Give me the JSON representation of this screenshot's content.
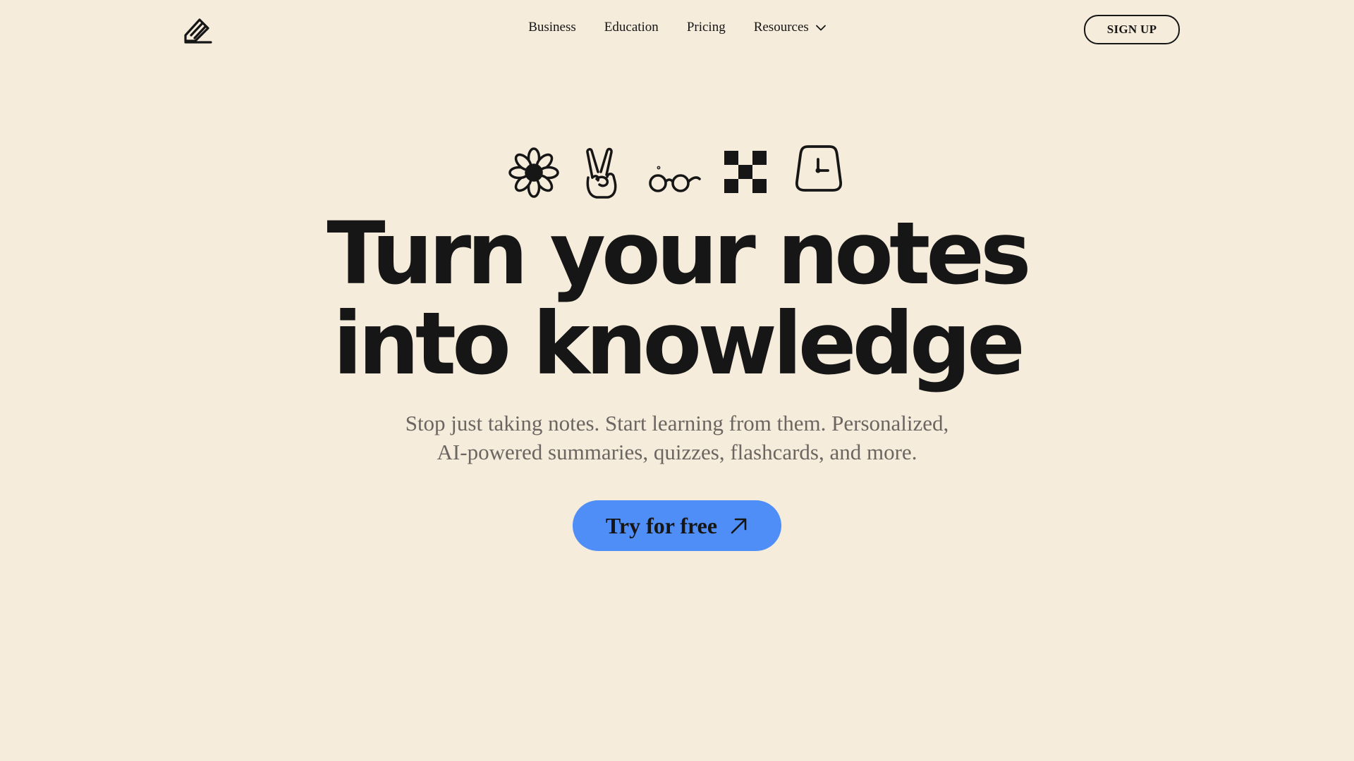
{
  "header": {
    "logo_icon": "pencil-notebook-icon",
    "nav": [
      {
        "label": "Business"
      },
      {
        "label": "Education"
      },
      {
        "label": "Pricing"
      },
      {
        "label": "Resources",
        "icon": "chevron-down-icon"
      }
    ],
    "signup_label": "SIGN UP"
  },
  "hero": {
    "icons": [
      "flower-icon",
      "peace-hand-icon",
      "glasses-icon",
      "checkerboard-icon",
      "clock-icon"
    ],
    "headline_lines": [
      "Turn your notes",
      "into knowledge"
    ],
    "subtitle_lines": [
      "Stop just taking notes. Start learning from them. Personalized,",
      "AI-powered summaries, quizzes, flashcards, and more."
    ],
    "cta_label": "Try for free",
    "cta_icon": "arrow-up-right-icon"
  },
  "colors": {
    "background": "#f5ecdb",
    "text": "#161616",
    "subtitle": "#6b6661",
    "accent": "#4f8ef7"
  }
}
